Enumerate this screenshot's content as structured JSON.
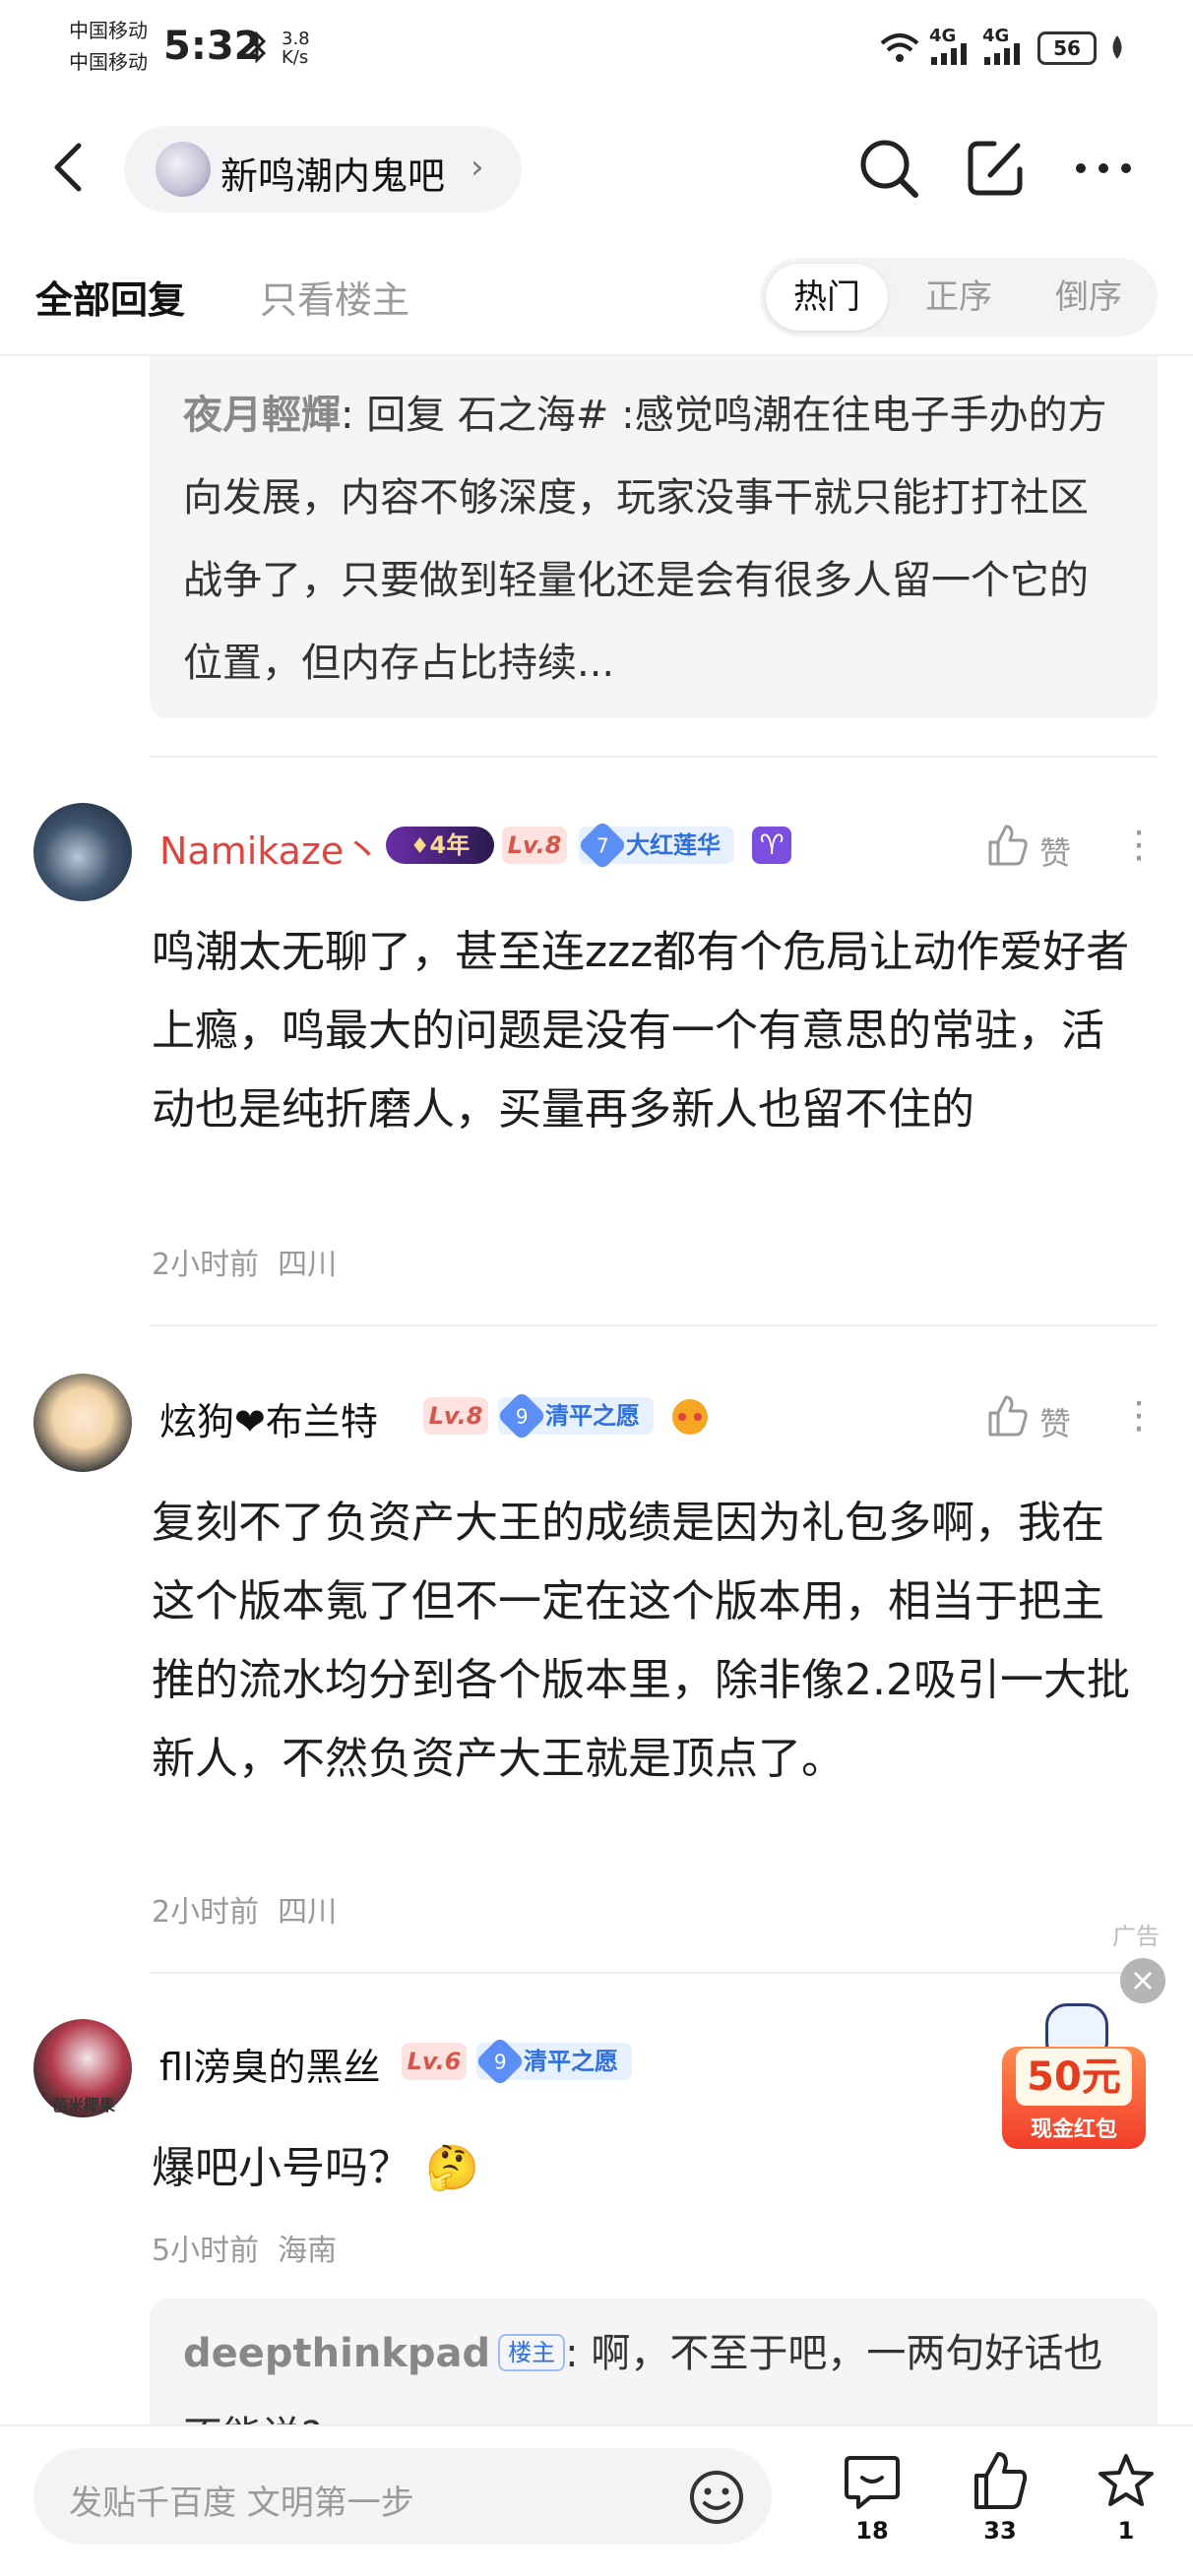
{
  "status_bar": {
    "carrier1": "中国移动",
    "carrier2": "中国移动",
    "time": "5:32",
    "speed_value": "3.8",
    "speed_unit": "K/s",
    "net1": "4G",
    "net2": "4G",
    "battery": "56"
  },
  "header": {
    "forum_name": "新鸣潮内鬼吧",
    "chevron": "›"
  },
  "tabs": {
    "all": "全部回复",
    "op_only": "只看楼主",
    "sort": [
      "热门",
      "正序",
      "倒序"
    ]
  },
  "quote": {
    "name": "夜月輕輝",
    "text": ": 回复 石之海# :感觉鸣潮在往电子手办的方向发展，内容不够深度，玩家没事干就只能打打社区战争了，只要做到轻量化还是会有很多人留一个它的位置，但内存占比持续..."
  },
  "comments": [
    {
      "username": "Namikaze丶",
      "year_badge": "4年",
      "level": "Lv.8",
      "title_num": "7",
      "title": "大红莲华",
      "zodiac": "♈",
      "like_label": "赞",
      "content": "鸣潮太无聊了，甚至连zzz都有个危局让动作爱好者上瘾，鸣最大的问题是没有一个有意思的常驻，活动也是纯折磨人，买量再多新人也留不住的",
      "time": "2小时前",
      "location": "四川"
    },
    {
      "username": "炫狗❤布兰特",
      "level": "Lv.8",
      "title_num": "9",
      "title": "清平之愿",
      "like_label": "赞",
      "content": "复刻不了负资产大王的成绩是因为礼包多啊，我在这个版本氪了但不一定在这个版本用，相当于把主推的流水均分到各个版本里，除非像2.2吸引一大批新人，不然负资产大王就是顶点了。",
      "time": "2小时前",
      "location": "四川"
    },
    {
      "username": "fll滂臭的黑丝",
      "avatar_text": "芭米椰果",
      "level": "Lv.6",
      "title_num": "9",
      "title": "清平之愿",
      "content": "爆吧小号吗？",
      "emoji": "🤔",
      "time": "5小时前",
      "location": "海南",
      "sub_reply": {
        "name": "deepthinkpad",
        "badge": "楼主",
        "text": ": 啊，不至于吧，一两句好话也不能说?"
      }
    }
  ],
  "ad": {
    "label": "广告",
    "close": "×",
    "amount": "50元",
    "subtitle": "现金红包"
  },
  "bottom_bar": {
    "placeholder": "发贴千百度 文明第一步",
    "comments_count": "18",
    "likes_count": "33",
    "favorites_count": "1"
  }
}
